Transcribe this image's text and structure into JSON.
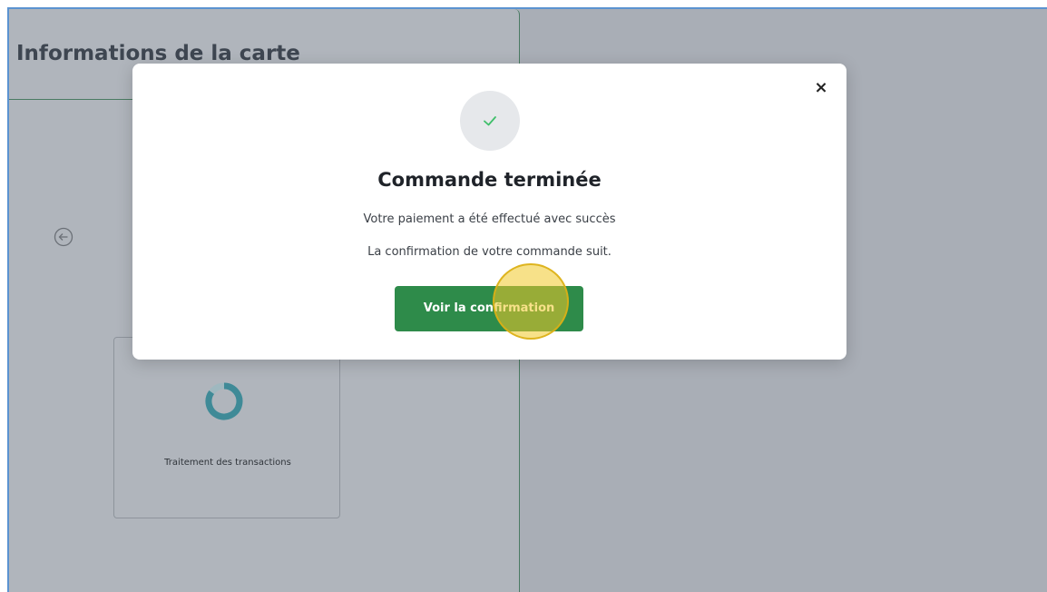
{
  "panel": {
    "title": "Informations de la carte",
    "back_icon": "arrow-left-circle-icon",
    "card": {
      "spinner_icon": "loading-spinner-icon",
      "label": "Traitement des transactions"
    }
  },
  "modal": {
    "close_label": "×",
    "success_icon": "checkmark-icon",
    "title": "Commande terminée",
    "line1": "Votre paiement a été effectué avec succès",
    "line2": "La confirmation de votre commande suit.",
    "button_label": "Voir la confirmation"
  },
  "colors": {
    "accent_green": "#2e8b4a",
    "check_green": "#3fbf6a",
    "spinner_teal": "#3f8a97",
    "overlay": "#a9aeb6",
    "highlight_yellow": "#f0c828"
  }
}
